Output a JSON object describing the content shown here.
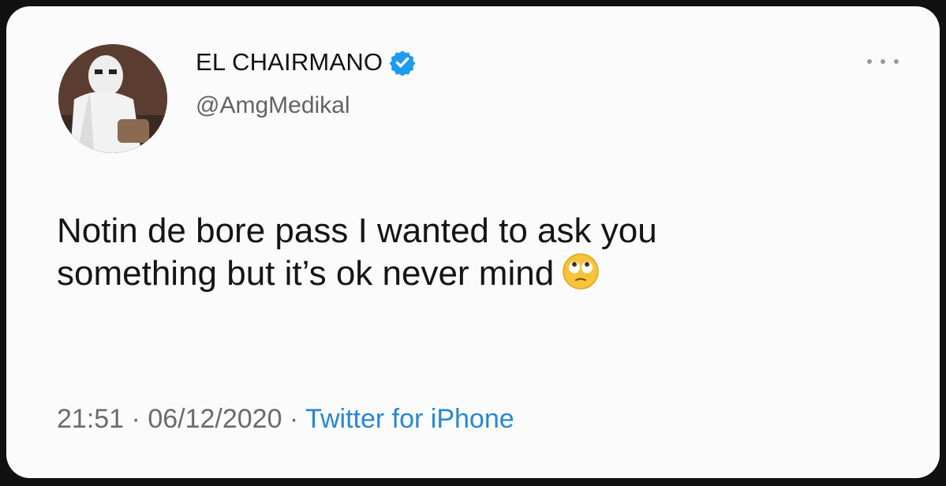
{
  "user": {
    "display_name": "EL CHAIRMANO",
    "handle": "@AmgMedikal",
    "verified": true
  },
  "tweet": {
    "line1": "Notin de bore pass I wanted to ask you",
    "line2": "something but it’s ok never mind",
    "emoji": "face-with-rolling-eyes"
  },
  "meta": {
    "time": "21:51",
    "separator": " · ",
    "date": "06/12/2020",
    "source": "Twitter for iPhone"
  },
  "colors": {
    "card_background": "#fbfbfb",
    "verified_badge": "#1d9bf0",
    "link": "#2a86d1",
    "text": "#151515",
    "muted": "#6b6b6b"
  },
  "icons": [
    "more-options-icon",
    "verified-badge-icon",
    "rolling-eyes-emoji-icon"
  ]
}
